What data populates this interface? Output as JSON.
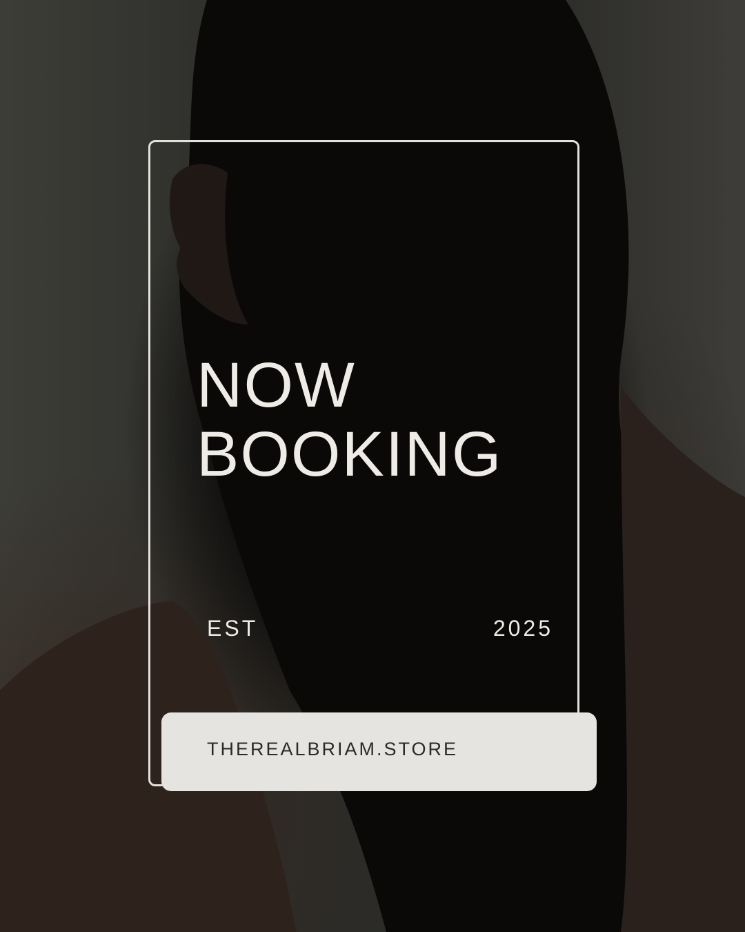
{
  "headline": {
    "line1": "NOW",
    "line2": "BOOKING"
  },
  "est_label": "EST",
  "year": "2025",
  "website": "THEREALBRIAM.STORE",
  "colors": {
    "text_light": "#efece8",
    "frame": "#e4e1dc",
    "pill": "#e5e4e0",
    "pill_text": "#2b2a28",
    "background": "#3a3a36"
  }
}
